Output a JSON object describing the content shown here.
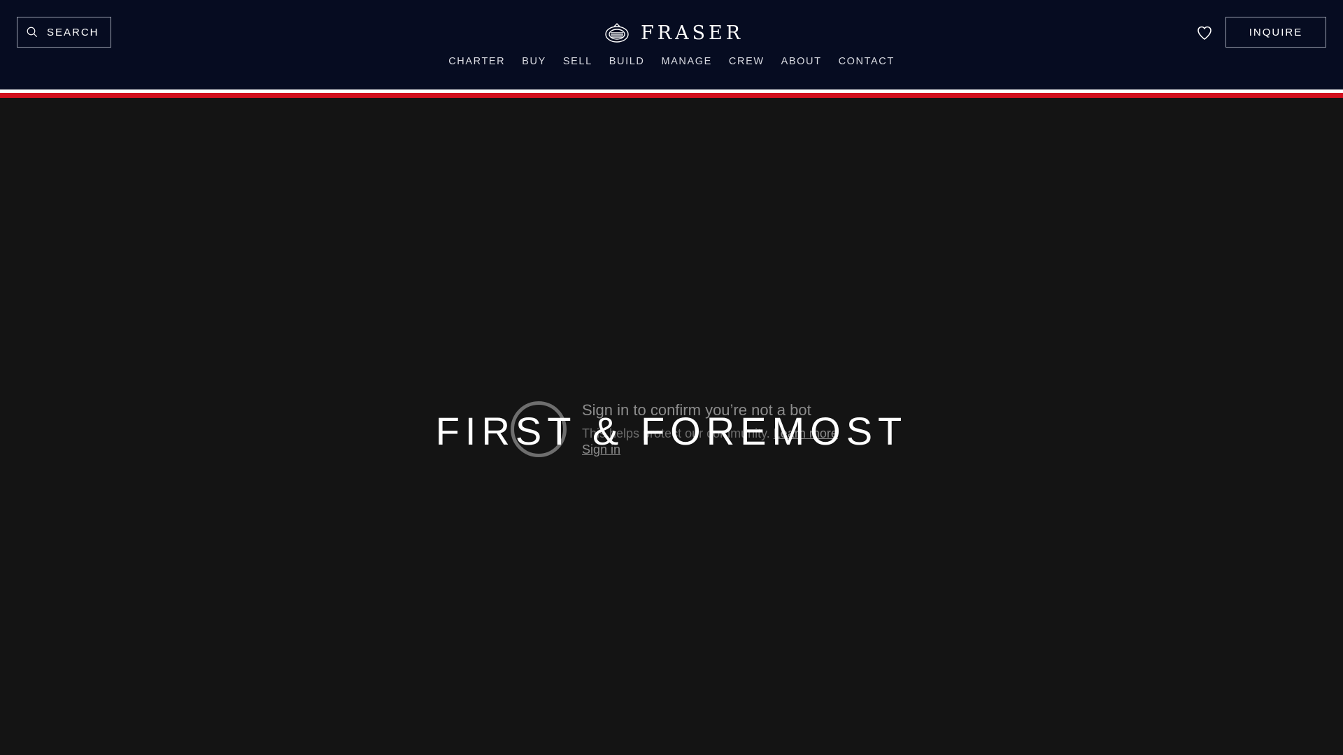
{
  "header": {
    "search_label": "SEARCH",
    "logo_text": "FRASER",
    "inquire_label": "INQUIRE",
    "nav": [
      {
        "label": "CHARTER"
      },
      {
        "label": "BUY"
      },
      {
        "label": "SELL"
      },
      {
        "label": "BUILD"
      },
      {
        "label": "MANAGE"
      },
      {
        "label": "CREW"
      },
      {
        "label": "ABOUT"
      },
      {
        "label": "CONTACT"
      }
    ]
  },
  "hero": {
    "title": "FIRST & FOREMOST"
  },
  "bot_check": {
    "title": "Sign in to confirm you’re not a bot",
    "description": "This helps protect our community.",
    "learn_more": "Learn more",
    "sign_in": "Sign in"
  },
  "icons": {
    "search": "search-icon",
    "logo": "fraser-emblem-icon",
    "wishlist": "heart-icon"
  },
  "colors": {
    "header_bg": "#060c21",
    "hero_bg": "#141414",
    "stripe_white": "#ffffff",
    "stripe_red": "#d2101e"
  }
}
